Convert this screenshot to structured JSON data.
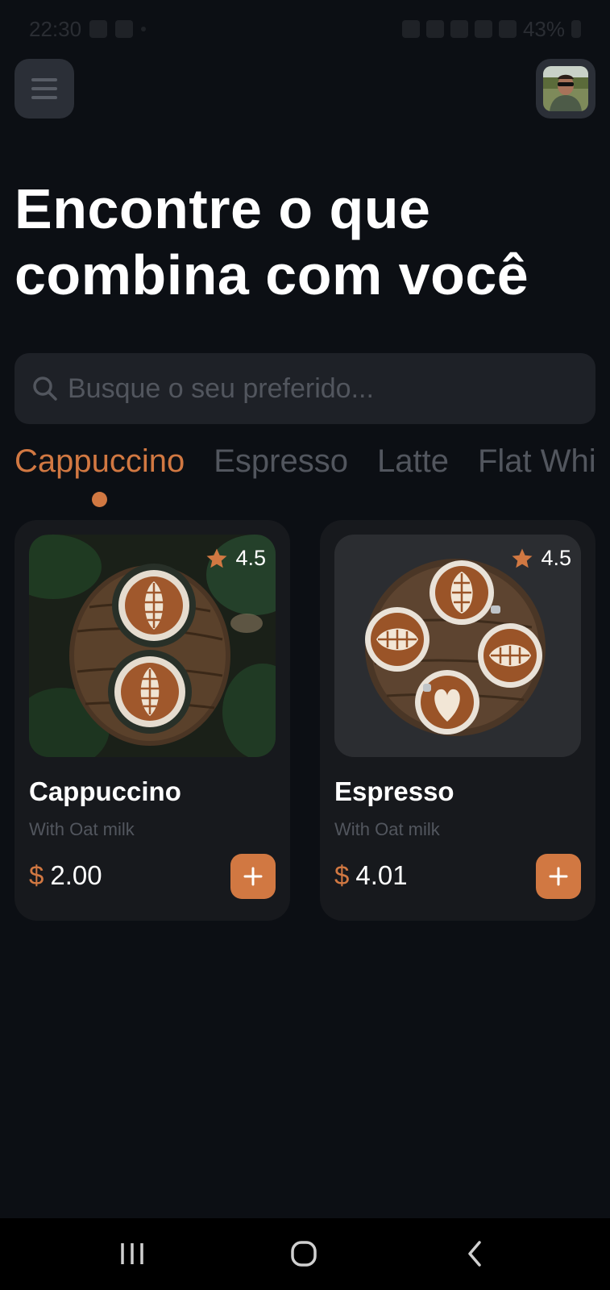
{
  "status_bar": {
    "time": "22:30",
    "battery": "43%"
  },
  "header": {
    "menu_icon": "hamburger-icon",
    "avatar_icon": "user-avatar"
  },
  "headline": {
    "line1": "Encontre o que",
    "line2": "combina com você"
  },
  "search": {
    "placeholder": "Busque o seu preferido...",
    "value": "",
    "icon": "search-icon"
  },
  "tabs": [
    {
      "label": "Cappuccino",
      "active": true
    },
    {
      "label": "Espresso",
      "active": false
    },
    {
      "label": "Latte",
      "active": false
    },
    {
      "label": "Flat White",
      "active": false
    }
  ],
  "products": [
    {
      "name": "Cappuccino",
      "subtitle": "With Oat milk",
      "currency": "$",
      "price": "2.00",
      "rating": "4.5",
      "image": "cappuccino-latte-art-photo"
    },
    {
      "name": "Espresso",
      "subtitle": "With Oat milk",
      "currency": "$",
      "price": "4.01",
      "rating": "4.5",
      "image": "espresso-latte-art-photo"
    }
  ],
  "colors": {
    "background": "#0c0f14",
    "accent": "#d17842",
    "card": "#17191d",
    "muted_text": "#52565e",
    "search_bg": "#1e2127"
  },
  "nav": {
    "recent_icon": "recent-apps-icon",
    "home_icon": "home-icon",
    "back_icon": "back-icon"
  }
}
